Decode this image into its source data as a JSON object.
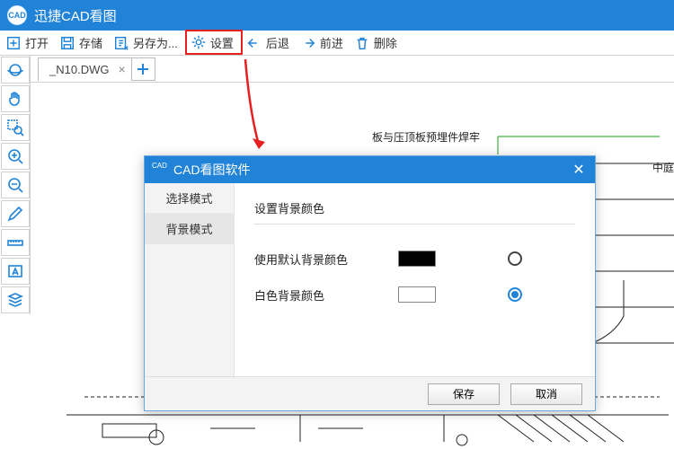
{
  "app": {
    "title": "迅捷CAD看图",
    "icon_label": "CAD"
  },
  "toolbar": {
    "open": "打开",
    "save": "存储",
    "save_as": "另存为...",
    "settings": "设置",
    "back": "后退",
    "forward": "前进",
    "delete": "删除"
  },
  "tabs": {
    "file": "_N10.DWG"
  },
  "canvas": {
    "label_weld": "板与压顶板预埋件焊牢",
    "label_mid": "中庭"
  },
  "dialog": {
    "title": "CAD看图软件",
    "side": {
      "select_mode": "选择模式",
      "bg_mode": "背景模式"
    },
    "section_title": "设置背景颜色",
    "opt_default": "使用默认背景颜色",
    "opt_white": "白色背景颜色",
    "save": "保存",
    "cancel": "取消"
  }
}
